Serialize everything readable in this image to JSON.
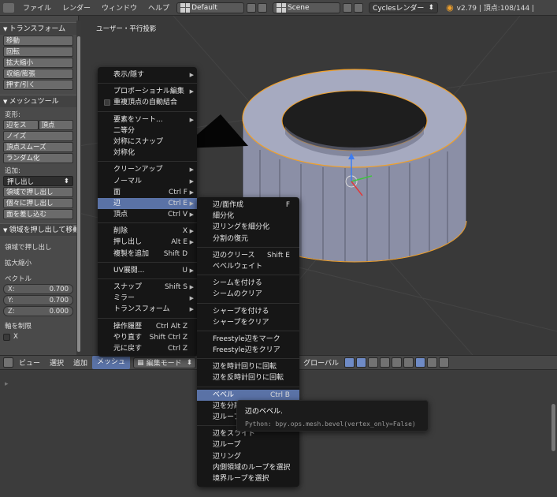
{
  "topbar": {
    "menus": [
      "ファイル",
      "レンダー",
      "ウィンドウ",
      "ヘルプ"
    ],
    "layout": "Default",
    "scene": "Scene",
    "engine": "Cyclesレンダー",
    "version_stats": "v2.79 | 頂点:108/144 |"
  },
  "toolshelf": {
    "transform_title": "トランスフォーム",
    "transform_buttons": [
      "移動",
      "回転",
      "拡大縮小",
      "収縮/膨張",
      "押す/引く"
    ],
    "meshtools_title": "メッシュツール",
    "deform_label": "変形:",
    "deform_row": [
      "辺をス",
      "頂点"
    ],
    "deform_buttons": [
      "ノイズ",
      "頂点スムーズ",
      "ランダム化"
    ],
    "add_label": "追加:",
    "extrude_select": "押し出し",
    "add_buttons": [
      "領域で押し出し",
      "個々に押し出し",
      "面を差し込む"
    ],
    "operator_title": "領域を押し出して移動",
    "op_label1": "領域で押し出し",
    "op_label2": "拡大縮小",
    "vector_label": "ベクトル",
    "vector": [
      {
        "k": "X:",
        "v": "0.700"
      },
      {
        "k": "Y:",
        "v": "0.700"
      },
      {
        "k": "Z:",
        "v": "0.000"
      }
    ],
    "constraint_label": "軸を制限",
    "constraint_x": "X"
  },
  "viewport": {
    "label": "ユーザー・平行投影"
  },
  "viewheader": {
    "items": [
      "ビュー",
      "選択",
      "追加"
    ],
    "active": "メッシュ",
    "mode": "編集モード",
    "pivot": "グローバル"
  },
  "mesh_menu": {
    "items": [
      {
        "label": "表示/隠す",
        "arrow": true
      },
      {
        "sep": true
      },
      {
        "label": "プロポーショナル編集",
        "arrow": true
      },
      {
        "label": "重複頂点の自動結合",
        "check": true
      },
      {
        "sep": true
      },
      {
        "label": "要素をソート...",
        "arrow": true
      },
      {
        "label": "二等分"
      },
      {
        "label": "対称にスナップ"
      },
      {
        "label": "対称化"
      },
      {
        "sep": true
      },
      {
        "label": "クリーンアップ",
        "arrow": true
      },
      {
        "label": "ノーマル",
        "arrow": true
      },
      {
        "label": "面",
        "shortcut": "Ctrl F",
        "arrow": true
      },
      {
        "label": "辺",
        "shortcut": "Ctrl E",
        "arrow": true,
        "highlight": true
      },
      {
        "label": "頂点",
        "shortcut": "Ctrl V",
        "arrow": true
      },
      {
        "sep": true
      },
      {
        "label": "削除",
        "shortcut": "X",
        "arrow": true
      },
      {
        "label": "押し出し",
        "shortcut": "Alt E",
        "arrow": true
      },
      {
        "label": "複製を追加",
        "shortcut": "Shift D"
      },
      {
        "sep": true
      },
      {
        "label": "UV展開...",
        "shortcut": "U",
        "arrow": true
      },
      {
        "sep": true
      },
      {
        "label": "スナップ",
        "shortcut": "Shift S",
        "arrow": true
      },
      {
        "label": "ミラー",
        "arrow": true
      },
      {
        "label": "トランスフォーム",
        "arrow": true
      },
      {
        "sep": true
      },
      {
        "label": "操作履歴",
        "shortcut": "Ctrl Alt Z"
      },
      {
        "label": "やり直す",
        "shortcut": "Shift Ctrl Z"
      },
      {
        "label": "元に戻す",
        "shortcut": "Ctrl Z"
      }
    ]
  },
  "edge_menu": {
    "items": [
      {
        "label": "辺/面作成",
        "shortcut": "F"
      },
      {
        "label": "細分化"
      },
      {
        "label": "辺リングを細分化"
      },
      {
        "label": "分割の復元"
      },
      {
        "sep": true
      },
      {
        "label": "辺のクリース",
        "shortcut": "Shift E"
      },
      {
        "label": "ベベルウェイト"
      },
      {
        "sep": true
      },
      {
        "label": "シームを付ける"
      },
      {
        "label": "シームのクリア"
      },
      {
        "sep": true
      },
      {
        "label": "シャープを付ける"
      },
      {
        "label": "シャープをクリア"
      },
      {
        "sep": true
      },
      {
        "label": "Freestyle辺をマーク"
      },
      {
        "label": "Freestyle辺をクリア"
      },
      {
        "sep": true
      },
      {
        "label": "辺を時計回りに回転"
      },
      {
        "label": "辺を反時計回りに回転"
      },
      {
        "sep": true
      },
      {
        "label": "ベベル",
        "shortcut": "Ctrl B",
        "highlight": true
      },
      {
        "label": "辺を分離"
      },
      {
        "label": "辺ループ"
      },
      {
        "sep": true
      },
      {
        "label": "辺をスライド"
      },
      {
        "label": "辺ループ"
      },
      {
        "label": "辺リング"
      },
      {
        "label": "内側領域のループを選択"
      },
      {
        "label": "境界ループを選択"
      }
    ]
  },
  "tooltip": {
    "title": "辺のベベル.",
    "python": "Python: bpy.ops.mesh.bevel(vertex_only=False)"
  },
  "colors": {
    "highlight": "#5a72a6",
    "mesh_face": "#9a9eb3",
    "mesh_edge": "#f0a02a"
  }
}
